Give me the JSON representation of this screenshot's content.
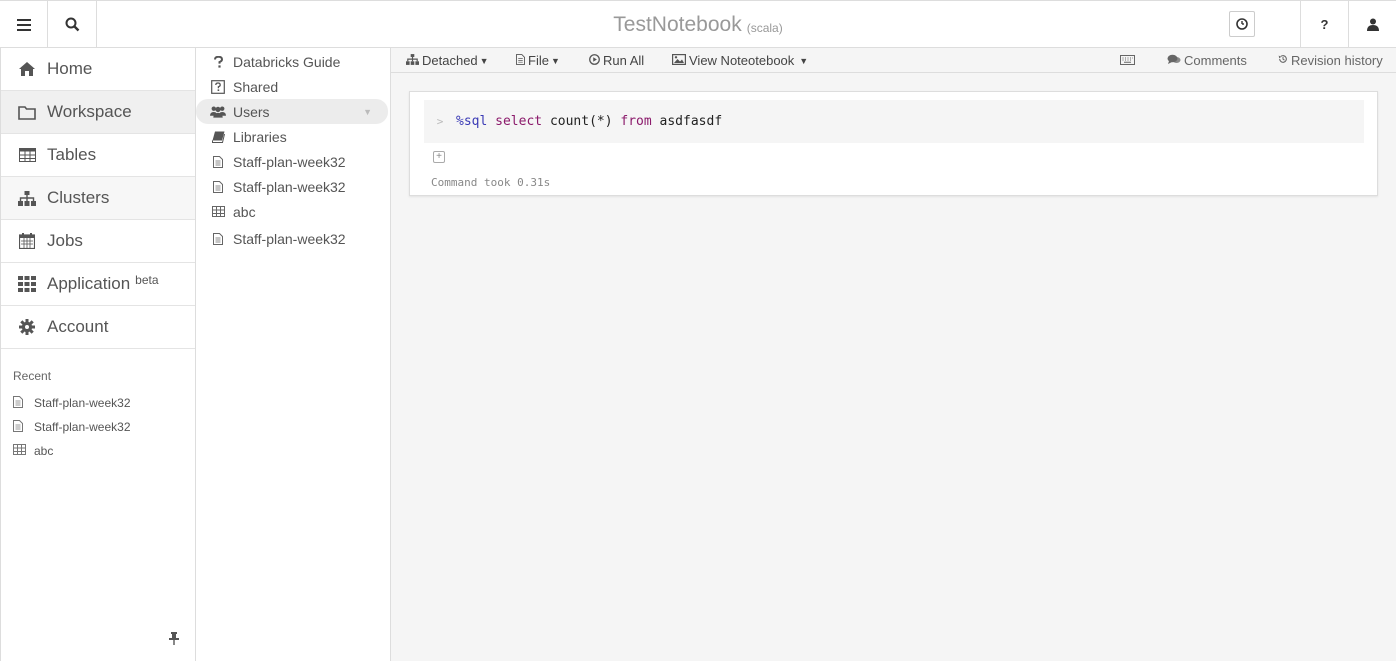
{
  "topbar": {
    "menu_icon": "hamburger-icon",
    "search_icon": "search-icon",
    "notebook_name": "TestNotebook",
    "notebook_lang": "(scala)",
    "help_label": "?",
    "clock_icon": "clock-icon",
    "user_icon": "user-icon"
  },
  "nav": {
    "items": [
      {
        "label": "Home",
        "icon": "home-icon"
      },
      {
        "label": "Workspace",
        "icon": "folder-icon"
      },
      {
        "label": "Tables",
        "icon": "table-icon"
      },
      {
        "label": "Clusters",
        "icon": "sitemap-icon"
      },
      {
        "label": "Jobs",
        "icon": "calendar-icon"
      },
      {
        "label": "Application",
        "icon": "grid-icon",
        "badge": "beta"
      },
      {
        "label": "Account",
        "icon": "gear-icon"
      }
    ],
    "recent_header": "Recent",
    "recent": [
      {
        "label": "Staff-plan-week32",
        "icon": "file-icon"
      },
      {
        "label": "Staff-plan-week32",
        "icon": "file-icon"
      },
      {
        "label": "abc",
        "icon": "table-icon"
      }
    ]
  },
  "tree": {
    "items": [
      {
        "label": "Databricks Guide",
        "icon": "question-icon"
      },
      {
        "label": "Shared",
        "icon": "question-box-icon"
      },
      {
        "label": "Users",
        "icon": "users-icon"
      },
      {
        "label": "Libraries",
        "icon": "book-icon"
      },
      {
        "label": "Staff-plan-week32",
        "icon": "file-icon"
      },
      {
        "label": "Staff-plan-week32",
        "icon": "file-icon"
      },
      {
        "label": "abc",
        "icon": "table-icon"
      },
      {
        "label": "Staff-plan-week32",
        "icon": "file-icon"
      }
    ]
  },
  "toolbar": {
    "detached": "Detached",
    "file": "File",
    "run_all": "Run All",
    "view": "View Noteotebook",
    "comments": "Comments",
    "revision": "Revision history"
  },
  "cell": {
    "magic": "%sql",
    "kw_select": "select",
    "expr": "count(*)",
    "kw_from": "from",
    "table": "asdfasdf",
    "took": "Command took 0.31s"
  }
}
